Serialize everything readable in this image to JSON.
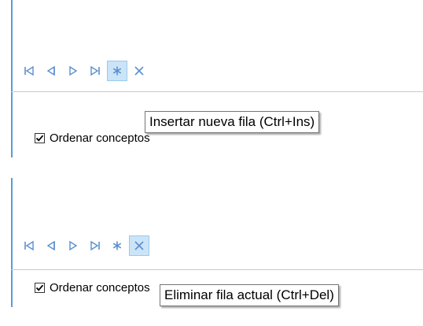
{
  "colors": {
    "accent_line": "#5b9bd5",
    "nav_icon": "#5a8fd0",
    "hover_bg": "#cce4f7",
    "hover_border": "#99c9ef"
  },
  "panels": [
    {
      "nav_buttons": [
        {
          "icon": "first-record-icon"
        },
        {
          "icon": "previous-record-icon"
        },
        {
          "icon": "next-record-icon"
        },
        {
          "icon": "last-record-icon"
        },
        {
          "icon": "insert-row-icon",
          "hovered": true
        },
        {
          "icon": "delete-row-icon"
        }
      ],
      "checkbox": {
        "label": "Ordenar conceptos",
        "checked": true
      },
      "tooltip": "Insertar nueva fila (Ctrl+Ins)"
    },
    {
      "nav_buttons": [
        {
          "icon": "first-record-icon"
        },
        {
          "icon": "previous-record-icon"
        },
        {
          "icon": "next-record-icon"
        },
        {
          "icon": "last-record-icon"
        },
        {
          "icon": "insert-row-icon"
        },
        {
          "icon": "delete-row-icon",
          "hovered": true
        }
      ],
      "checkbox": {
        "label": "Ordenar conceptos",
        "checked": true
      },
      "tooltip": "Eliminar fila actual (Ctrl+Del)"
    }
  ]
}
